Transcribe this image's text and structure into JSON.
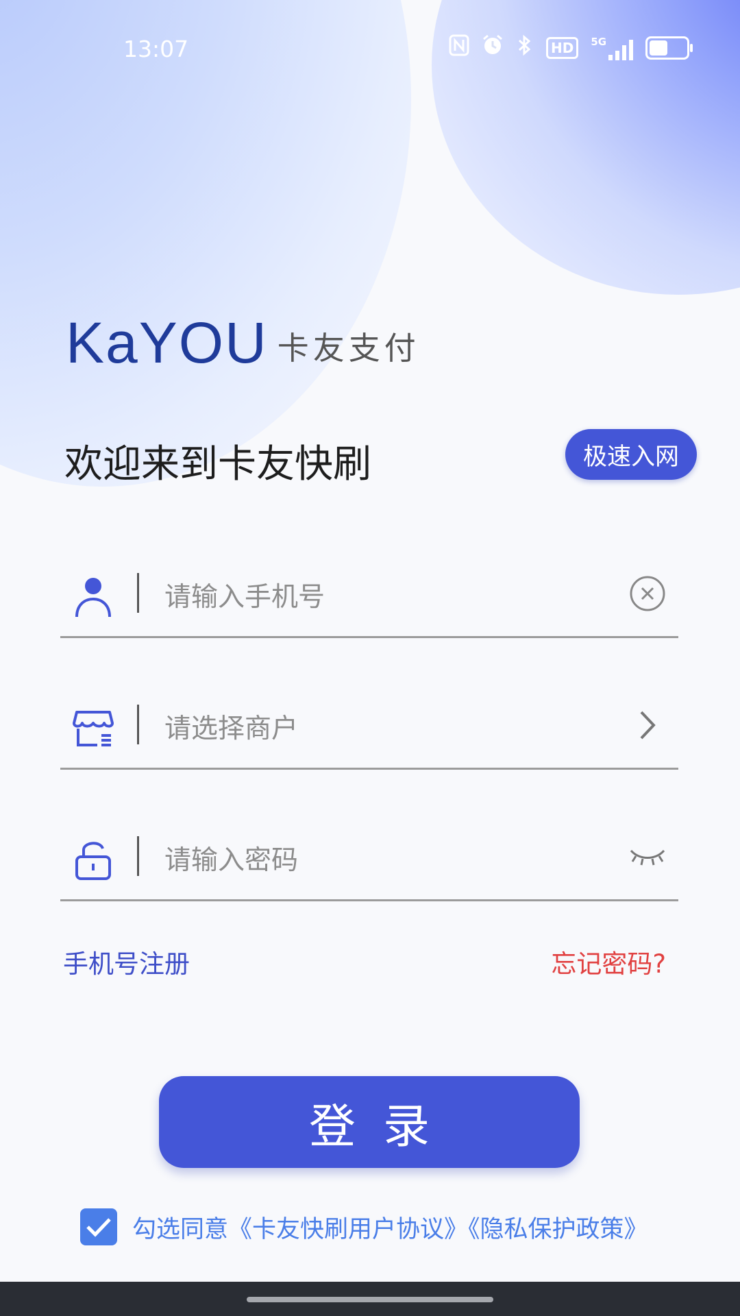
{
  "status_bar": {
    "time": "13:07",
    "icons": [
      "nfc-icon",
      "alarm-icon",
      "bluetooth-icon",
      "hd-icon",
      "signal-5g-icon",
      "battery-icon"
    ],
    "hd_label": "HD",
    "network_label": "5G",
    "battery_level": 0.5
  },
  "brand": {
    "logo_text": "KaYOU",
    "logo_sub": "卡友支付",
    "welcome": "欢迎来到卡友快刷"
  },
  "quick_join_label": "极速入网",
  "form": {
    "phone_placeholder": "请输入手机号",
    "phone_value": "",
    "merchant_placeholder": "请选择商户",
    "merchant_value": "",
    "password_placeholder": "请输入密码",
    "password_value": ""
  },
  "links": {
    "register": "手机号注册",
    "forgot": "忘记密码?"
  },
  "login_label": "登录",
  "agreement": {
    "checked": true,
    "text": "勾选同意《卡友快刷用户协议》《隐私保护政策》"
  },
  "colors": {
    "primary": "#4456d7",
    "link_blue": "#3e4ec8",
    "warn_red": "#e14141",
    "check_blue": "#4a7ee8"
  }
}
